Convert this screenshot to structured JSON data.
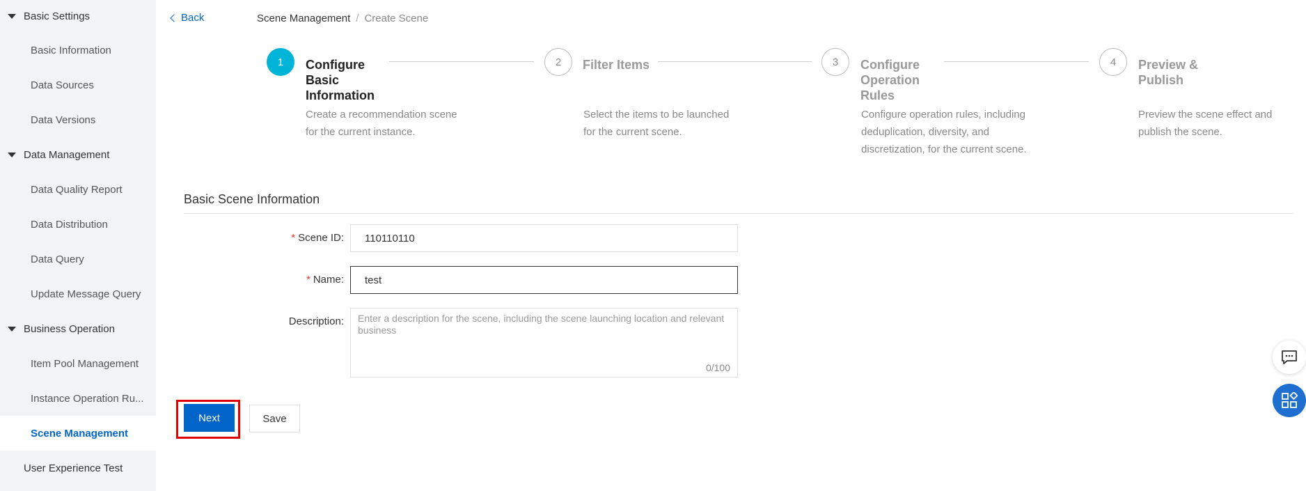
{
  "sidebar": {
    "groups": [
      {
        "label": "Basic Settings",
        "items": [
          "Basic Information",
          "Data Sources",
          "Data Versions"
        ]
      },
      {
        "label": "Data Management",
        "items": [
          "Data Quality Report",
          "Data Distribution",
          "Data Query",
          "Update Message Query"
        ]
      },
      {
        "label": "Business Operation",
        "items": [
          "Item Pool Management",
          "Instance Operation Ru...",
          "Scene Management"
        ]
      }
    ],
    "active": "Scene Management",
    "footer_item": "User Experience Test"
  },
  "header": {
    "back_label": "Back",
    "breadcrumb": [
      "Scene Management",
      "/",
      "Create Scene"
    ]
  },
  "steps": [
    {
      "number": "1",
      "title": "Configure Basic Information",
      "desc": "Create a recommendation scene for the current instance."
    },
    {
      "number": "2",
      "title": "Filter Items",
      "desc": "Select the items to be launched for the current scene."
    },
    {
      "number": "3",
      "title": "Configure Operation Rules",
      "desc": "Configure operation rules, including deduplication, diversity, and discretization, for the current scene."
    },
    {
      "number": "4",
      "title": "Preview & Publish",
      "desc": "Preview the scene effect and publish the scene."
    }
  ],
  "form": {
    "section_title": "Basic Scene Information",
    "required_mark": "*",
    "scene_id_label": "Scene ID:",
    "scene_id_value": "110110110",
    "name_label": "Name:",
    "name_value": "test",
    "description_label": "Description:",
    "description_placeholder": "Enter a description for the scene, including the scene launching location and relevant business",
    "description_counter": "0/100"
  },
  "buttons": {
    "next": "Next",
    "save": "Save"
  },
  "colors": {
    "primary": "#0064c8",
    "step_active": "#00b4d8",
    "highlight": "#e30000",
    "required": "#e53935"
  }
}
